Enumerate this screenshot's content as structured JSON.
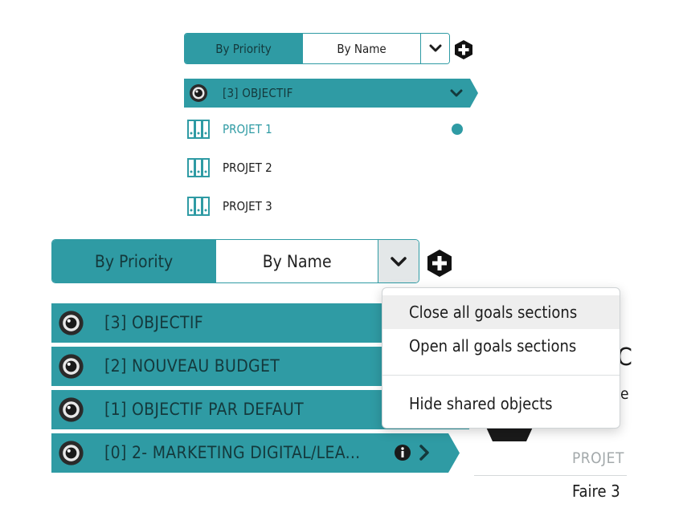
{
  "small_view": {
    "sort": {
      "priority_label": "By Priority",
      "name_label": "By Name"
    },
    "goal": {
      "label": "[3] OBJECTIF"
    },
    "projects": [
      {
        "label": "PROJET 1",
        "active": true
      },
      {
        "label": "PROJET 2",
        "active": false
      },
      {
        "label": "PROJET 3",
        "active": false
      }
    ]
  },
  "large_view": {
    "sort": {
      "priority_label": "By Priority",
      "name_label": "By Name"
    },
    "goals": [
      {
        "label": "[3] OBJECTIF"
      },
      {
        "label": "[2] NOUVEAU BUDGET"
      },
      {
        "label": "[1] OBJECTIF PAR DEFAUT"
      },
      {
        "label": "[0] 2- MARKETING DIGITAL/LEA..."
      }
    ]
  },
  "dropdown": {
    "items": [
      {
        "label": "Close all goals sections"
      },
      {
        "label": "Open all goals sections"
      },
      {
        "label": "Hide shared objects"
      }
    ]
  },
  "background_panel": {
    "big_letter": "C",
    "small_letter": "e",
    "column_label": "PROJET",
    "row_text": "Faire 3"
  },
  "colors": {
    "teal": "#2f9ba4",
    "dark_text": "#14393c"
  },
  "icons": [
    "plus-hexagon-icon",
    "eye-target-icon",
    "chevron-down-icon",
    "binders-icon",
    "info-icon",
    "chevron-right-icon"
  ]
}
